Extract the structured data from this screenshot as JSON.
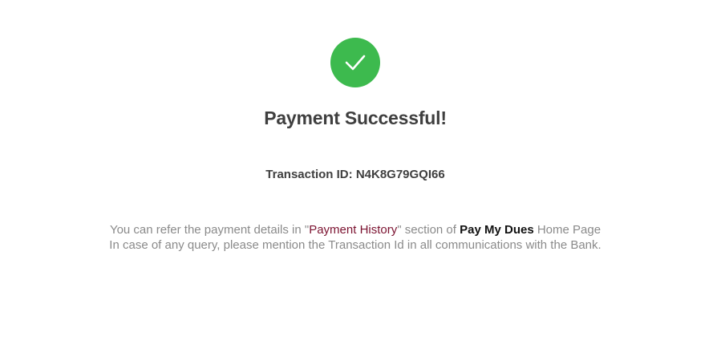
{
  "status": {
    "icon": "check-icon",
    "color": "#3dba4e",
    "title": "Payment Successful!"
  },
  "transaction": {
    "label": "Transaction ID:",
    "id": "N4K8G79GQI66"
  },
  "info": {
    "line1_prefix": "You can refer the payment details in \"",
    "line1_link": "Payment History",
    "line1_mid": "\" section of ",
    "line1_brand": "Pay My Dues",
    "line1_suffix": " Home Page",
    "line2": "In case of any query, please mention the Transaction Id in all communications with the Bank."
  }
}
